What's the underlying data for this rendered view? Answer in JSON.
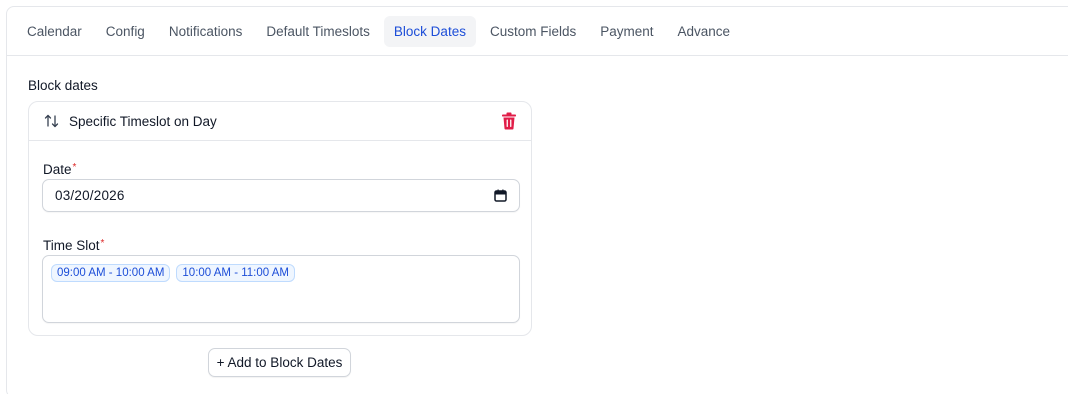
{
  "tabs": [
    {
      "label": "Calendar",
      "active": false
    },
    {
      "label": "Config",
      "active": false
    },
    {
      "label": "Notifications",
      "active": false
    },
    {
      "label": "Default Timeslots",
      "active": false
    },
    {
      "label": "Block Dates",
      "active": true
    },
    {
      "label": "Custom Fields",
      "active": false
    },
    {
      "label": "Payment",
      "active": false
    },
    {
      "label": "Advance",
      "active": false
    }
  ],
  "section": {
    "title": "Block dates"
  },
  "card": {
    "title": "Specific Timeslot on Day",
    "sort_icon": "arrows-up-down-icon",
    "delete_icon": "trash-icon",
    "date": {
      "label": "Date",
      "required_mark": "*",
      "value": "03/20/2026",
      "icon": "calendar-icon"
    },
    "time_slot": {
      "label": "Time Slot",
      "required_mark": "*",
      "chips": [
        "09:00 AM - 10:00 AM",
        "10:00 AM - 11:00 AM"
      ]
    }
  },
  "add_button": {
    "label": "+ Add to Block Dates"
  },
  "colors": {
    "accent": "#1d4ed8",
    "danger": "#e11d48",
    "border": "#e5e7eb"
  }
}
